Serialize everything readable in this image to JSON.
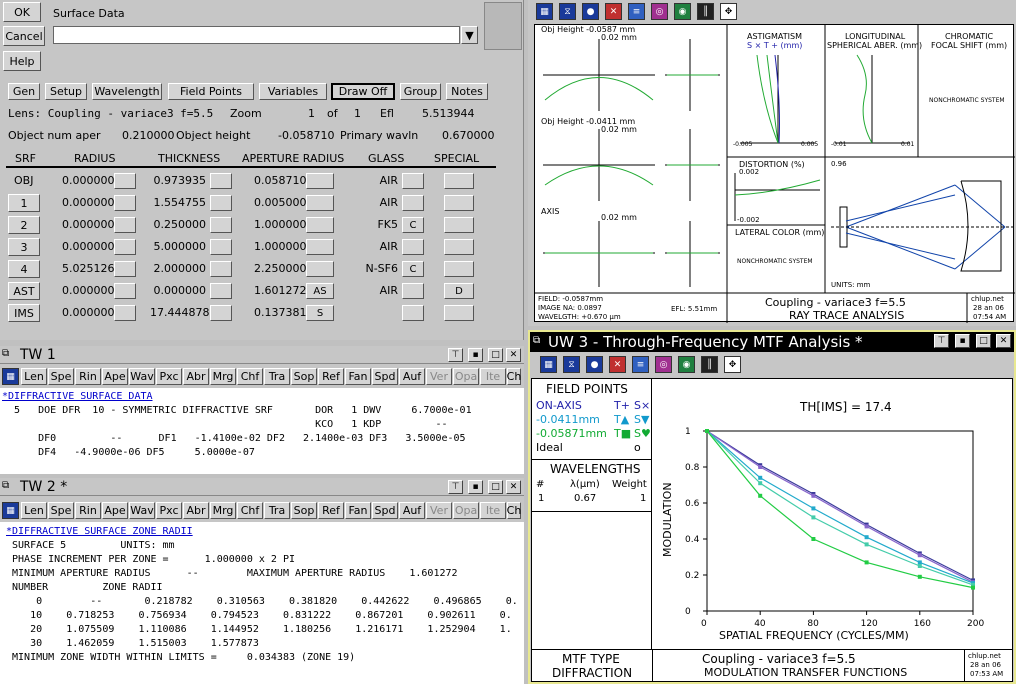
{
  "surface_data": {
    "ok": "OK",
    "cancel": "Cancel",
    "help": "Help",
    "title": "Surface Data",
    "tabs": [
      "Gen",
      "Setup",
      "Wavelength",
      "Field Points",
      "Variables",
      "Draw Off",
      "Group",
      "Notes"
    ],
    "lens_line": "Lens: Coupling - variace3 f=5.5",
    "zoom_label": "Zoom",
    "zoom_value": "1",
    "zoom_of": "of",
    "zoom_total": "1",
    "efl_label": "Efl",
    "efl_value": "5.513944",
    "obj_aper_label": "Object num aper",
    "obj_aper_value": "0.210000",
    "obj_height_label": "Object height",
    "obj_height_value": "-0.058710",
    "wavln_label": "Primary wavln",
    "wavln_value": "0.670000",
    "headers": [
      "SRF",
      "RADIUS",
      "THICKNESS",
      "APERTURE RADIUS",
      "GLASS",
      "SPECIAL"
    ],
    "rows": [
      {
        "srf": "OBJ",
        "radius": "0.000000",
        "thickness": "0.973935",
        "aperture": "0.058710",
        "ap_flag": "",
        "glass": "AIR",
        "glass_flag": "",
        "special": ""
      },
      {
        "srf": "1",
        "radius": "0.000000",
        "thickness": "1.554755",
        "aperture": "0.005000",
        "ap_flag": "",
        "glass": "AIR",
        "glass_flag": "",
        "special": ""
      },
      {
        "srf": "2",
        "radius": "0.000000",
        "thickness": "0.250000",
        "aperture": "1.000000",
        "ap_flag": "",
        "glass": "FK5",
        "glass_flag": "C",
        "special": ""
      },
      {
        "srf": "3",
        "radius": "0.000000",
        "thickness": "5.000000",
        "aperture": "1.000000",
        "ap_flag": "",
        "glass": "AIR",
        "glass_flag": "",
        "special": ""
      },
      {
        "srf": "4",
        "radius": "5.025126",
        "thickness": "2.000000",
        "aperture": "2.250000",
        "ap_flag": "",
        "glass": "N-SF6",
        "glass_flag": "C",
        "special": ""
      },
      {
        "srf": "AST",
        "radius": "0.000000",
        "thickness": "0.000000",
        "aperture": "1.601272",
        "ap_flag": "AS",
        "glass": "AIR",
        "glass_flag": "",
        "special": "D"
      },
      {
        "srf": "IMS",
        "radius": "0.000000",
        "thickness": "17.444878",
        "aperture": "0.137381",
        "ap_flag": "S",
        "glass": "",
        "glass_flag": "",
        "special": ""
      }
    ]
  },
  "toolbar_tabs": [
    "Len",
    "Spe",
    "Rin",
    "Ape",
    "Wav",
    "Pxc",
    "Abr",
    "Mrg",
    "Chf",
    "Tra",
    "Sop",
    "Ref",
    "Fan",
    "Spd",
    "Auf",
    "Ver",
    "Opa",
    "Ite",
    "Ch"
  ],
  "tw1": {
    "title": "TW 1",
    "heading": "*DIFFRACTIVE SURFACE DATA",
    "lines": [
      "  5   DOE DFR  10 - SYMMETRIC DIFFRACTIVE SRF       DOR   1 DWV     6.7000e-01",
      "                                                    KCO   1 KDP         --",
      "      DF0         --      DF1   -1.4100e-02 DF2   2.1400e-03 DF3   3.5000e-05",
      "      DF4   -4.9000e-06 DF5     5.0000e-07"
    ]
  },
  "tw2": {
    "title": "TW 2 *",
    "heading": "*DIFFRACTIVE SURFACE ZONE RADII",
    "lines": [
      " SURFACE 5         UNITS: mm",
      " PHASE INCREMENT PER ZONE =      1.000000 x 2 PI",
      " MINIMUM APERTURE RADIUS      --        MAXIMUM APERTURE RADIUS    1.601272",
      " NUMBER         ZONE RADII",
      "     0        --       0.218782    0.310563    0.381820    0.442622    0.496865    0.",
      "    10    0.718253    0.756934    0.794523    0.831222    0.867201    0.902611    0.",
      "    20    1.075509    1.110086    1.144952    1.180256    1.216171    1.252904    1.",
      "    30    1.462059    1.515003    1.577873",
      " MINIMUM ZONE WIDTH WITHIN LIMITS =     0.034383 (ZONE 19)"
    ]
  },
  "ray_trace": {
    "obj_heights": [
      "Obj Height -0.0587 mm",
      "Obj Height -0.0411 mm",
      "AXIS"
    ],
    "scale": "0.02 mm",
    "astig_title": "ASTIGMATISM",
    "astig_sub": "S × T + (mm)",
    "astig_ticks": [
      "-0.005",
      "0.005"
    ],
    "long_title": "LONGITUDINAL",
    "long_sub": "SPHERICAL ABER. (mm)",
    "long_ticks": [
      "-0.01",
      "0.01"
    ],
    "chrom_title": "CHROMATIC",
    "chrom_sub": "FOCAL SHIFT (mm)",
    "nonchrom": "NONCHROMATIC SYSTEM",
    "dist_title": "DISTORTION (%)",
    "dist_top": "0.002",
    "dist_bottom": "-0.002",
    "lat_title": "LATERAL COLOR (mm)",
    "lat_nonchrom": "NONCHROMATIC SYSTEM",
    "layout_scale": "0.96",
    "units": "UNITS: mm",
    "field": "FIELD: -0.0587mm",
    "image_na": "IMAGE NA: 0.0897",
    "wavelgth": "WAVELGTH: +0.670 μm",
    "efl": "EFL: 5.51mm",
    "lens": "Coupling - variace3 f=5.5",
    "analysis": "RAY TRACE ANALYSIS",
    "user": "chlup.net",
    "date": "28 an 06",
    "time": "07:54 AM"
  },
  "uw3": {
    "title": "UW 3 - Through-Frequency MTF Analysis *",
    "field_points_title": "FIELD POINTS",
    "field_points": [
      {
        "label": "ON-AXIS",
        "t": "T+",
        "s": "S×",
        "color": "#2222aa"
      },
      {
        "label": "-0.0411mm",
        "t": "T▲",
        "s": "S▼",
        "color": "#1199cc"
      },
      {
        "label": "-0.05871mm",
        "t": "T■",
        "s": "S♥",
        "color": "#11aa33"
      },
      {
        "label": "Ideal",
        "t": "",
        "s": "o",
        "color": "#000000"
      }
    ],
    "wavelengths_title": "WAVELENGTHS",
    "wl_headers": [
      "#",
      "λ(μm)",
      "Weight"
    ],
    "wl_row": [
      "1",
      "0.67",
      "1"
    ],
    "mtf_type_title": "MTF TYPE",
    "mtf_type": "DIFFRACTION",
    "lens": "Coupling - variace3 f=5.5",
    "footer": "MODULATION TRANSFER FUNCTIONS",
    "user": "chlup.net",
    "date": "28 an 06",
    "time": "07:53 AM"
  },
  "chart_data": {
    "type": "line",
    "title": "TH[IMS] = 17.4",
    "xlabel": "SPATIAL FREQUENCY (CYCLES/MM)",
    "ylabel": "MODULATION",
    "xlim": [
      0,
      200
    ],
    "ylim": [
      0,
      1
    ],
    "x_ticks": [
      "0",
      "40",
      "80",
      "120",
      "160",
      "200"
    ],
    "y_ticks": [
      "0",
      "0.2",
      "0.4",
      "0.6",
      "0.8",
      "1"
    ],
    "x": [
      0,
      40,
      80,
      120,
      160,
      200
    ],
    "series": [
      {
        "values": [
          1,
          0.81,
          0.65,
          0.48,
          0.32,
          0.17
        ],
        "color": "#3a3a9a"
      },
      {
        "values": [
          1,
          0.8,
          0.64,
          0.47,
          0.31,
          0.16
        ],
        "color": "#8866cc"
      },
      {
        "values": [
          1,
          0.74,
          0.57,
          0.41,
          0.27,
          0.155
        ],
        "color": "#22aacc"
      },
      {
        "values": [
          1,
          0.71,
          0.52,
          0.37,
          0.25,
          0.145
        ],
        "color": "#44ccaa"
      },
      {
        "values": [
          1,
          0.64,
          0.4,
          0.27,
          0.19,
          0.13
        ],
        "color": "#22cc44"
      }
    ]
  }
}
